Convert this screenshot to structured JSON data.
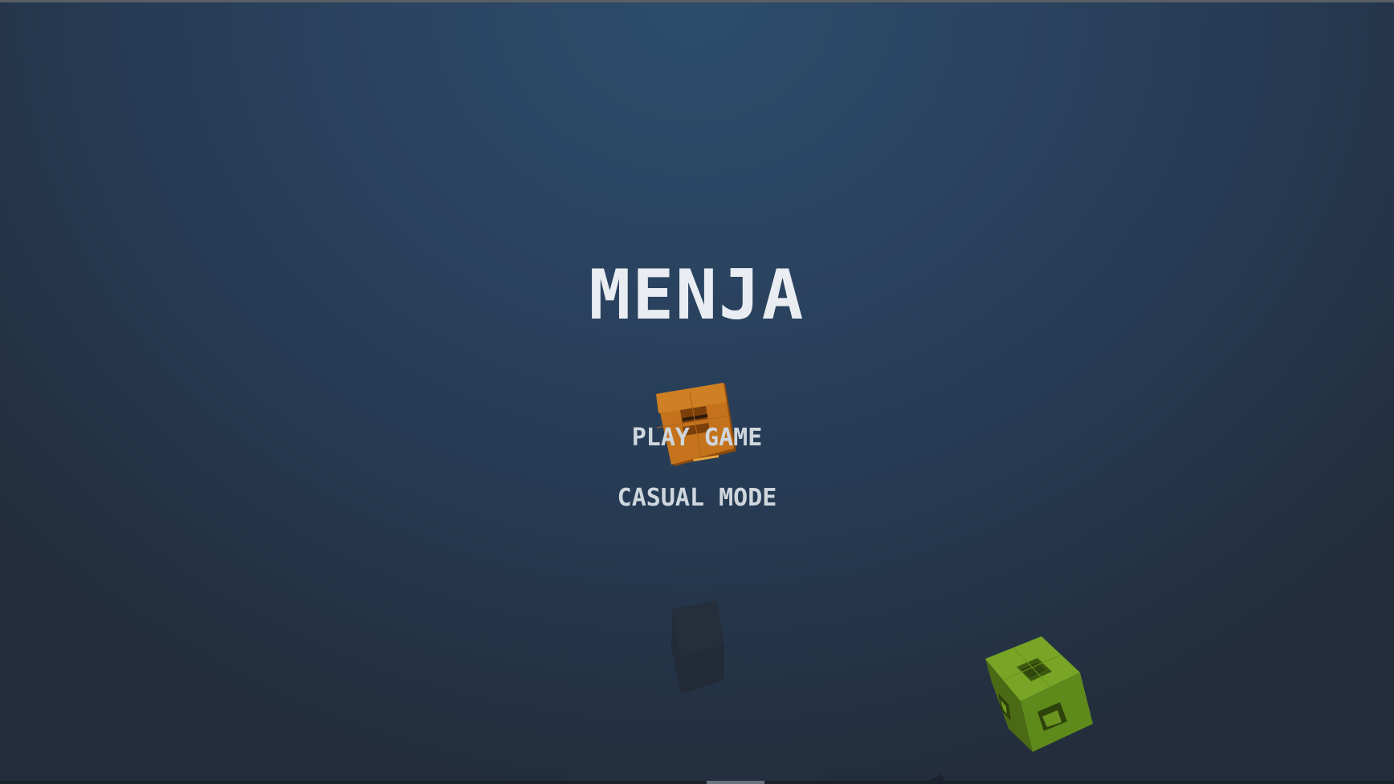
{
  "game": {
    "title": "MENJA"
  },
  "menu": {
    "items": [
      {
        "label": "PLAY GAME"
      },
      {
        "label": "CASUAL MODE"
      }
    ]
  },
  "cubes": [
    {
      "name": "orange-cube",
      "color": "#c4731c"
    },
    {
      "name": "dark-block",
      "color": "#222b37"
    },
    {
      "name": "green-cube",
      "color": "#6b941f"
    }
  ],
  "colors": {
    "background_top": "#2d4d6b",
    "background_bottom": "#232d3c",
    "title_text": "#e9edf1",
    "menu_text": "#cfd6dd"
  }
}
